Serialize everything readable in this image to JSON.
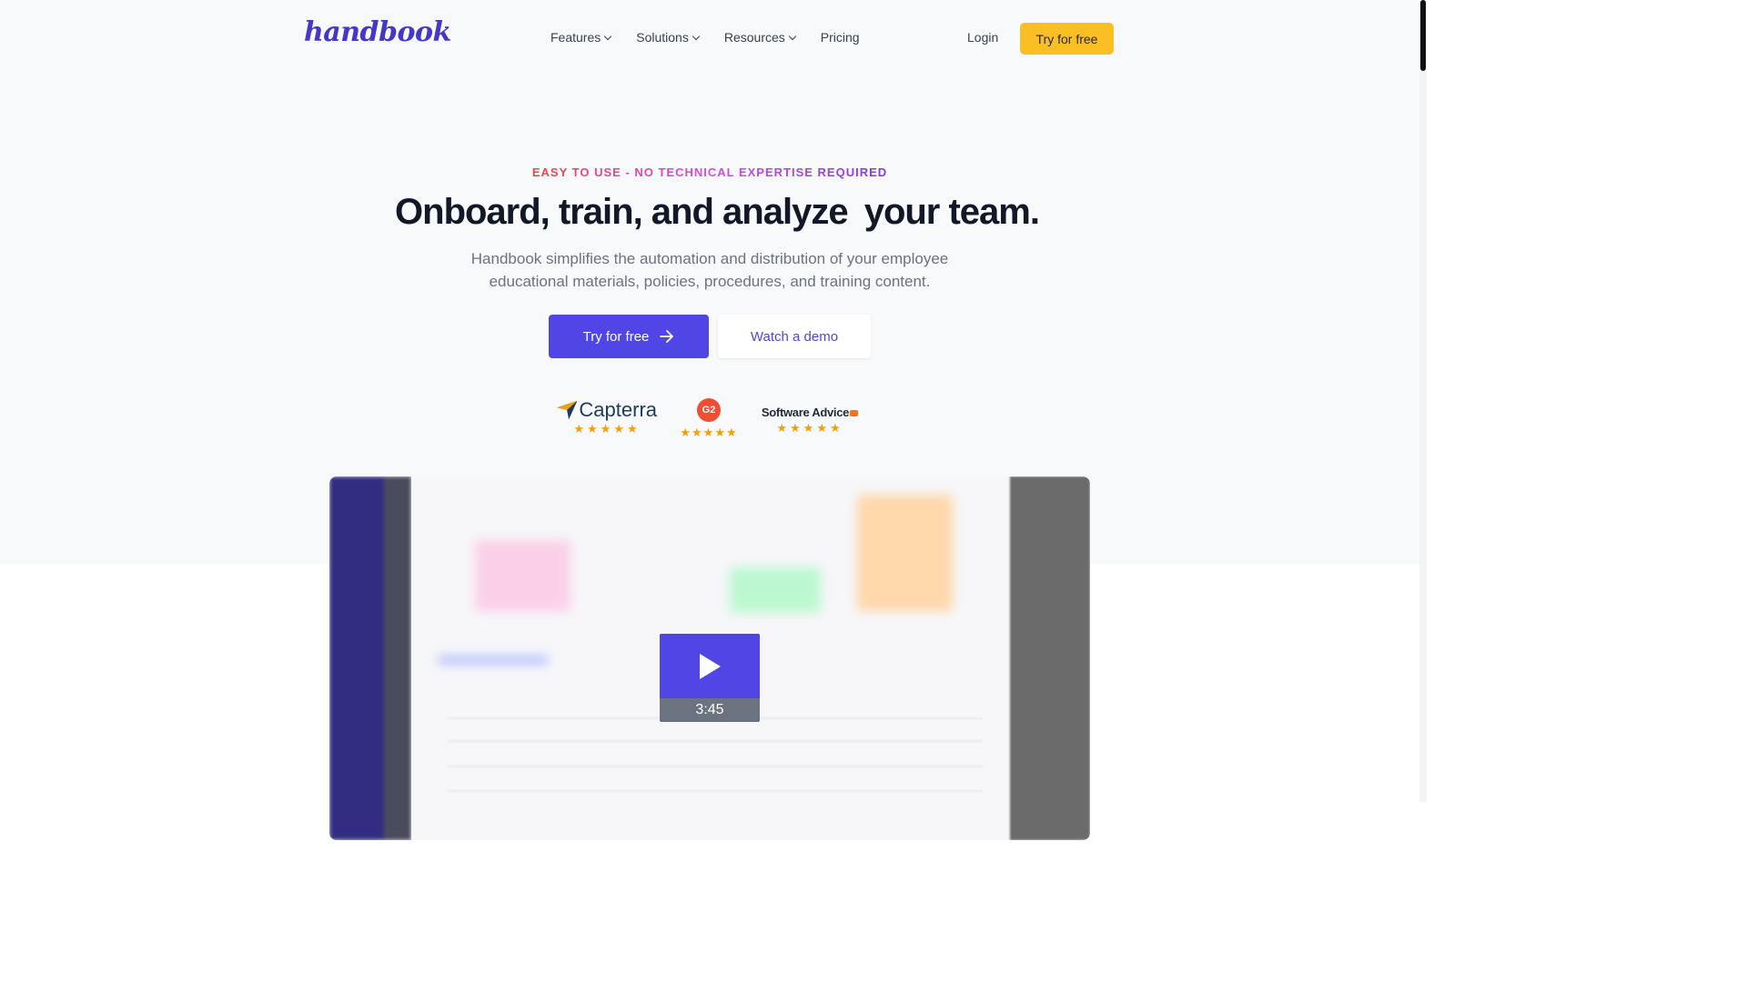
{
  "header": {
    "logo": "handbook",
    "nav": [
      {
        "label": "Features",
        "dropdown": true
      },
      {
        "label": "Solutions",
        "dropdown": true
      },
      {
        "label": "Resources",
        "dropdown": true
      },
      {
        "label": "Pricing",
        "dropdown": false
      }
    ],
    "login": "Login",
    "cta": "Try for free"
  },
  "hero": {
    "eyebrow": "EASY TO USE - NO TECHNICAL EXPERTISE REQUIRED",
    "headline_highlight": "Onboard, train, and analyze",
    "headline_rest": " your team.",
    "subtext_line1": "Handbook simplifies the automation and distribution of your employee",
    "subtext_line2": "educational materials, policies, procedures, and training content.",
    "primary_cta": "Try for free",
    "secondary_cta": "Watch a demo"
  },
  "ratings": [
    {
      "name": "Capterra",
      "stars": "★★★★★"
    },
    {
      "name": "G2",
      "stars": "★★★★★"
    },
    {
      "name": "Software Advice",
      "stars": "★★★★★"
    }
  ],
  "video": {
    "duration": "3:45"
  },
  "colors": {
    "brand": "#4f46e5",
    "accent": "#fbbf24",
    "highlight": "#fde047"
  }
}
